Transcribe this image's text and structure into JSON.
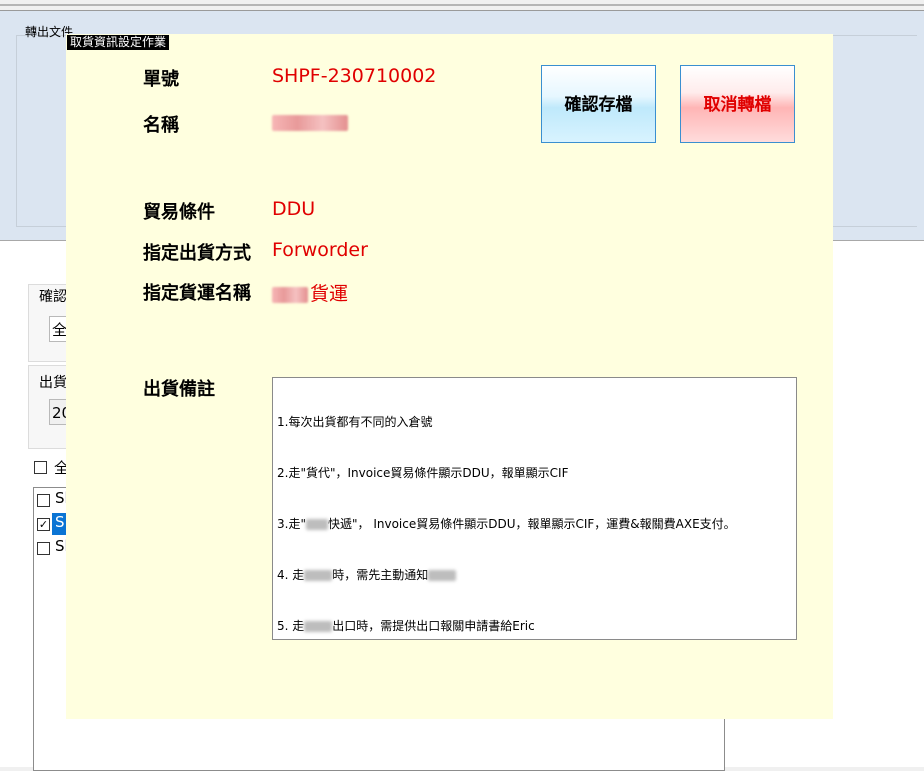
{
  "background": {
    "export_label": "轉出文件",
    "side_labels": [
      "確認",
      "出貨"
    ],
    "side_fields": [
      "全",
      "20"
    ],
    "select_all_label": "全",
    "list_items": [
      {
        "text": "Sl",
        "checked": false,
        "selected": false
      },
      {
        "text": "S",
        "checked": true,
        "selected": true
      },
      {
        "text": "Sl",
        "checked": false,
        "selected": false
      }
    ]
  },
  "dialog": {
    "title": "取貨資訊設定作業",
    "fields": {
      "order_no": {
        "label": "單號",
        "value": "SHPF-230710002"
      },
      "name": {
        "label": "名稱",
        "value": ""
      },
      "trade_terms": {
        "label": "貿易條件",
        "value": "DDU"
      },
      "shipping_method": {
        "label": "指定出貨方式",
        "value": "Forworder"
      },
      "carrier_name": {
        "label": "指定貨運名稱",
        "value_suffix": "貨運"
      },
      "notes": {
        "label": "出貨備註"
      }
    },
    "buttons": {
      "save": "確認存檔",
      "cancel": "取消轉檔"
    },
    "notes_lines": [
      {
        "parts": [
          "1.每次出貨都有不同的入倉號"
        ]
      },
      {
        "parts": [
          "2.走\"貨代\"，Invoice貿易條件顯示DDU，報單顯示CIF"
        ]
      },
      {
        "parts": [
          "3.走\"",
          "快遞\"， Invoice貿易條件顯示DDU，報單顯示CIF，運費&報關費AXE支付。"
        ]
      },
      {
        "parts": [
          "4. 走",
          "時，需先主動通知"
        ]
      },
      {
        "parts": [
          "5. 走",
          "出口時，需提供出口報關申請書給Eric"
        ]
      }
    ]
  },
  "colors": {
    "dialog_bg": "#ffffdf",
    "value_red": "#e00000",
    "top_panel_bg": "#dbe5f1",
    "selection_blue": "#0a74d4"
  }
}
